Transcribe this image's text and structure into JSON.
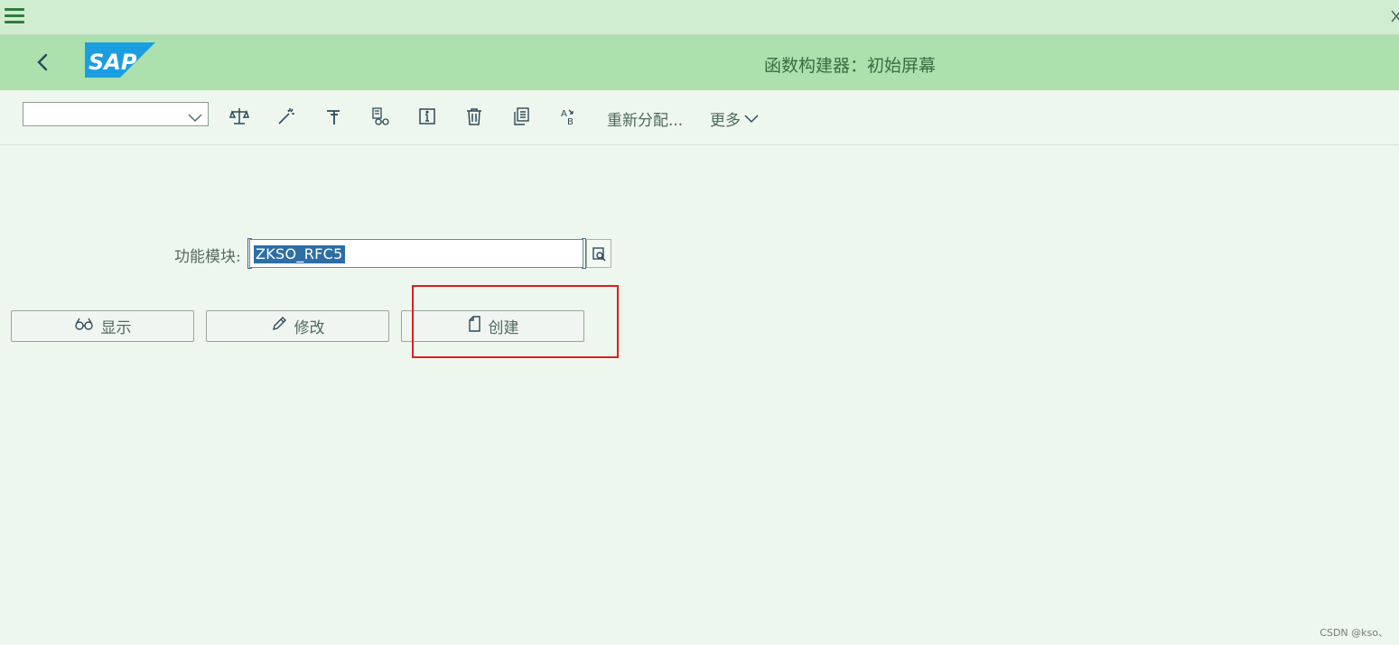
{
  "window": {
    "title": "函数构建器：初始屏幕"
  },
  "toolbar": {
    "select_value": "",
    "reassign_label": "重新分配...",
    "more_label": "更多"
  },
  "form": {
    "function_module_label": "功能模块:",
    "function_module_value": "ZKSO_RFC5"
  },
  "actions": {
    "display_label": "显示",
    "change_label": "修改",
    "create_label": "创建"
  },
  "watermark": "CSDN @kso、",
  "colors": {
    "menubar": "#d1edd1",
    "shellbar": "#ace0ac",
    "background": "#eef7ee",
    "highlight": "#e01c1c",
    "sap_blue": "#1b9ee0"
  },
  "icons": [
    "menu-icon",
    "close-icon",
    "back-icon",
    "sap-logo",
    "balance-icon",
    "magic-wand-icon",
    "pin-icon",
    "where-used-icon",
    "info-icon",
    "delete-icon",
    "copy-icon",
    "rename-icon",
    "value-help-icon",
    "glasses-icon",
    "pencil-icon",
    "document-icon"
  ]
}
